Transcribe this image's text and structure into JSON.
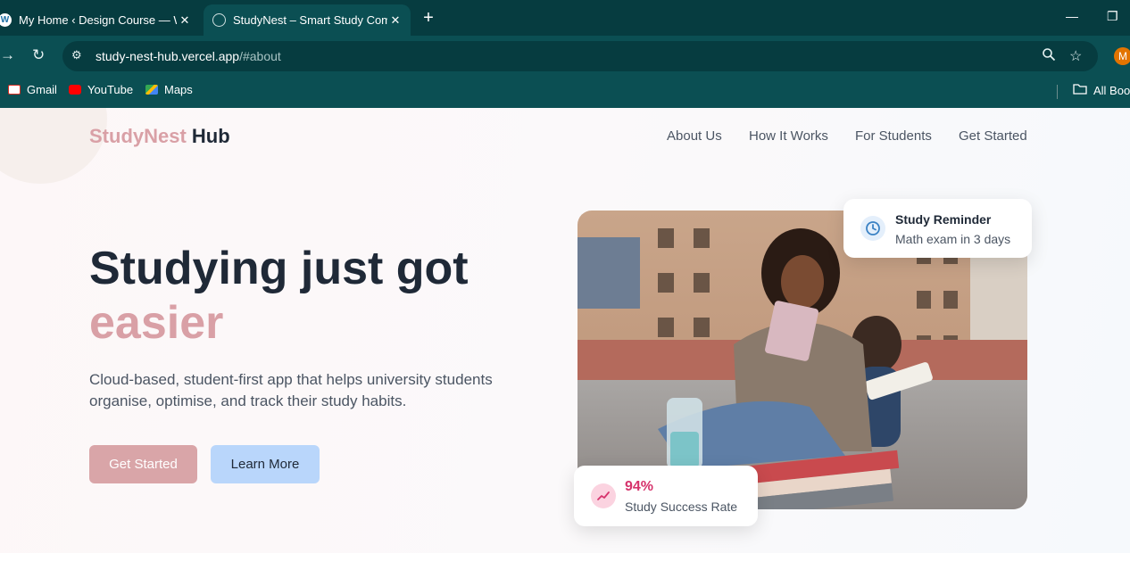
{
  "browser": {
    "tabs": [
      {
        "title": "My Home ‹ Design Course — W",
        "close": "✕"
      },
      {
        "title": "StudyNest – Smart Study Comp",
        "close": "✕"
      }
    ],
    "new_tab": "+",
    "window_controls": {
      "minimize": "—",
      "restore": "❐"
    },
    "url_host": "study-nest-hub.vercel.app",
    "url_path": "/#about",
    "profile_initial": "M",
    "bookmarks": [
      {
        "label": "Gmail",
        "icon": "gmail-icon"
      },
      {
        "label": "YouTube",
        "icon": "youtube-icon"
      },
      {
        "label": "Maps",
        "icon": "maps-icon"
      }
    ],
    "all_bookmarks": "All Book"
  },
  "page": {
    "brand": {
      "part1": "StudyNest",
      "part2": "Hub"
    },
    "nav": [
      "About Us",
      "How It Works",
      "For Students",
      "Get Started"
    ],
    "hero": {
      "headline_line1": "Studying just got",
      "headline_line2": "easier",
      "subtitle": "Cloud-based, student-first app that helps university students organise, optimise, and track their study habits.",
      "primary_button": "Get Started",
      "secondary_button": "Learn More"
    },
    "reminder_card": {
      "title": "Study Reminder",
      "detail": "Math exam in 3 days",
      "icon": "clock-icon"
    },
    "stat_card": {
      "value": "94%",
      "label": "Study Success Rate",
      "icon": "trend-icon"
    }
  },
  "colors": {
    "brand_accent": "#d9a0a6",
    "text_dark": "#1f2937",
    "chrome_dark": "#063c40",
    "chrome_mid": "#0b4f53",
    "secondary_button": "#b9d6fb",
    "stat_accent": "#d6336c"
  }
}
